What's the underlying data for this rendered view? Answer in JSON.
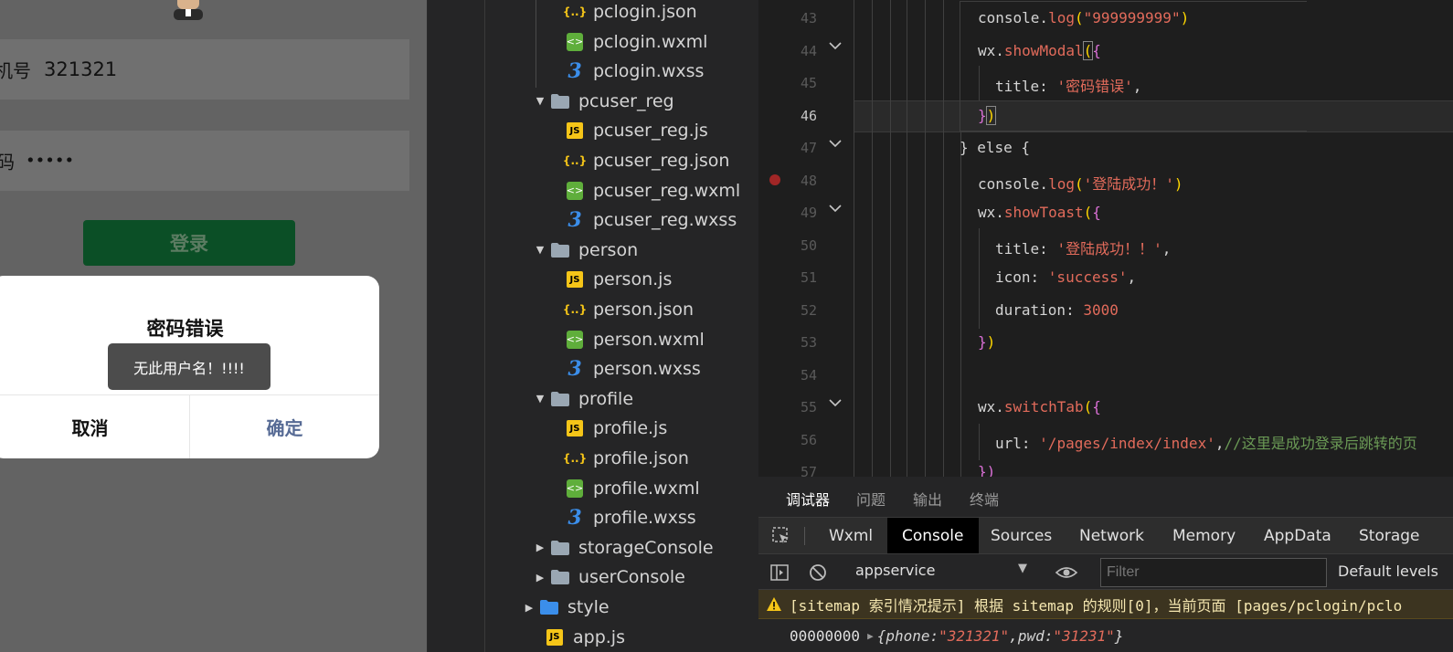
{
  "simulator": {
    "phone_label": "机号",
    "phone_value": "321321",
    "pwd_label": "码",
    "pwd_value": "•••••",
    "login_button": "登录",
    "modal": {
      "title": "密码错误",
      "cancel": "取消",
      "confirm": "确定"
    },
    "toast": "无此用户名！!!!!"
  },
  "file_tree": {
    "items": [
      {
        "name": "pclogin.json",
        "type": "json"
      },
      {
        "name": "pclogin.wxml",
        "type": "wxml"
      },
      {
        "name": "pclogin.wxss",
        "type": "wxss"
      },
      {
        "name": "pcuser_reg",
        "type": "folder-open"
      },
      {
        "name": "pcuser_reg.js",
        "type": "js"
      },
      {
        "name": "pcuser_reg.json",
        "type": "json"
      },
      {
        "name": "pcuser_reg.wxml",
        "type": "wxml"
      },
      {
        "name": "pcuser_reg.wxss",
        "type": "wxss"
      },
      {
        "name": "person",
        "type": "folder-open"
      },
      {
        "name": "person.js",
        "type": "js"
      },
      {
        "name": "person.json",
        "type": "json"
      },
      {
        "name": "person.wxml",
        "type": "wxml"
      },
      {
        "name": "person.wxss",
        "type": "wxss"
      },
      {
        "name": "profile",
        "type": "folder-open"
      },
      {
        "name": "profile.js",
        "type": "js"
      },
      {
        "name": "profile.json",
        "type": "json"
      },
      {
        "name": "profile.wxml",
        "type": "wxml"
      },
      {
        "name": "profile.wxss",
        "type": "wxss"
      },
      {
        "name": "storageConsole",
        "type": "folder-closed"
      },
      {
        "name": "userConsole",
        "type": "folder-closed"
      },
      {
        "name": "style",
        "type": "folder-style"
      },
      {
        "name": "app.js",
        "type": "js"
      }
    ]
  },
  "editor": {
    "line_numbers": [
      "43",
      "44",
      "45",
      "46",
      "47",
      "48",
      "49",
      "50",
      "51",
      "52",
      "53",
      "54",
      "55",
      "56",
      "57"
    ],
    "active_line": "46",
    "code": {
      "l43_a": "console.",
      "l43_b": "log",
      "l43_c": "(",
      "l43_d": "\"999999999\"",
      "l43_e": ")",
      "l44_a": "wx.",
      "l44_b": "showModal",
      "l44_c": "(",
      "l44_d": "{",
      "l45_a": "title: ",
      "l45_b": "'密码错误'",
      "l45_c": ",",
      "l46_a": "}",
      "l46_b": ")",
      "l47": "} else {",
      "l48_a": "console.",
      "l48_b": "log",
      "l48_c": "(",
      "l48_d": "'登陆成功！'",
      "l48_e": ")",
      "l49_a": "wx.",
      "l49_b": "showToast",
      "l49_c": "(",
      "l49_d": "{",
      "l50_a": "title: ",
      "l50_b": "'登陆成功！！'",
      "l50_c": ",",
      "l51_a": "icon: ",
      "l51_b": "'success'",
      "l51_c": ",",
      "l52_a": "duration: ",
      "l52_b": "3000",
      "l53_a": "}",
      "l53_b": ")",
      "l55_a": "wx.",
      "l55_b": "switchTab",
      "l55_c": "(",
      "l55_d": "{",
      "l56_a": "url: ",
      "l56_b": "'/pages/index/index'",
      "l56_c": ",",
      "l56_d": "//这里是成功登录后跳转的页",
      "l57_a": "})"
    }
  },
  "devtools": {
    "tabs": [
      "调试器",
      "问题",
      "输出",
      "终端"
    ],
    "subtabs": [
      "Wxml",
      "Console",
      "Sources",
      "Network",
      "Memory",
      "AppData",
      "Storage"
    ],
    "active_subtab": "Console",
    "context": "appservice",
    "filter_placeholder": "Filter",
    "levels": "Default levels",
    "warning": "[sitemap 索引情况提示] 根据 sitemap 的规则[0]，当前页面 [pages/pclogin/pclo",
    "log_prefix": "00000000",
    "log_obj": {
      "open": "{",
      "phone_key": "phone: ",
      "phone_val": "\"321321\"",
      "sep": ", ",
      "pwd_key": "pwd: ",
      "pwd_val": "\"31231\"",
      "close": "}"
    }
  },
  "colors": {
    "editor_bg": "#1e1e1e",
    "sidebar_bg": "#252526",
    "string": "#e26b5b",
    "bracket": "#ffd700",
    "comment": "#6a9955",
    "login_btn": "#0b4f26",
    "modal_ok": "#576b95"
  }
}
